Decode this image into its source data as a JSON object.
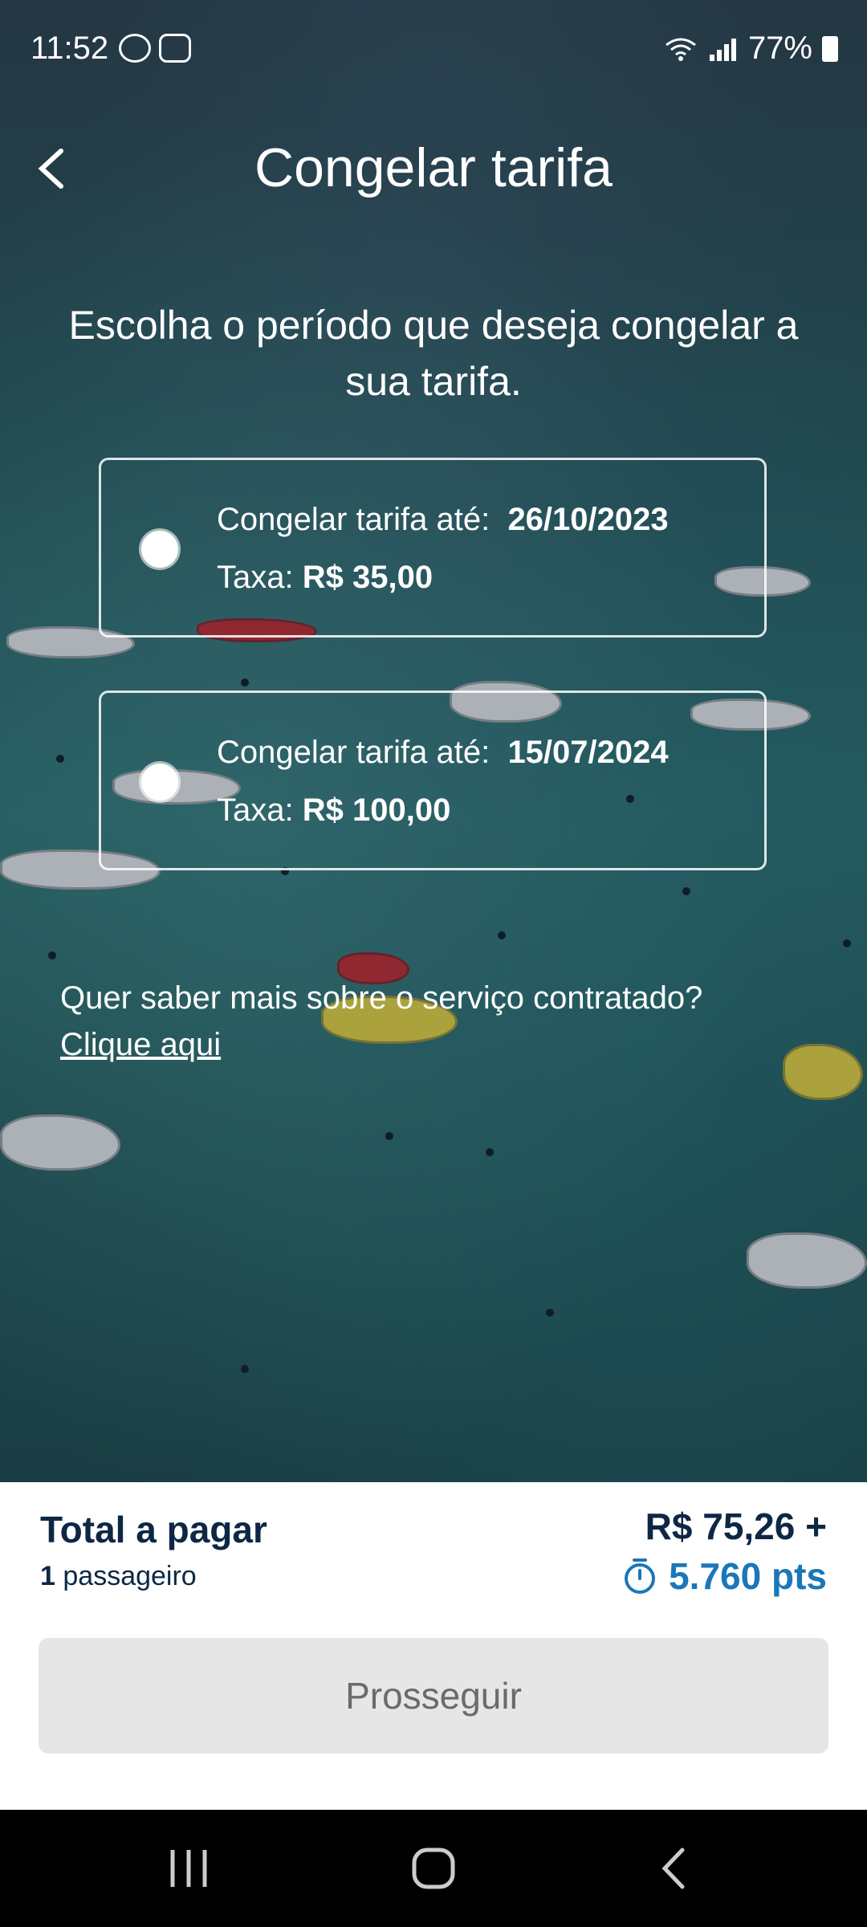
{
  "status_bar": {
    "time": "11:52",
    "battery": "77%"
  },
  "header": {
    "title": "Congelar tarifa"
  },
  "prompt": "Escolha o período que deseja congelar a sua tarifa.",
  "options": [
    {
      "label": "Congelar tarifa até:",
      "date": "26/10/2023",
      "fee_label": "Taxa:",
      "fee": "R$ 35,00",
      "selected": false
    },
    {
      "label": "Congelar tarifa até:",
      "date": "15/07/2024",
      "fee_label": "Taxa:",
      "fee": "R$ 100,00",
      "selected": false
    }
  ],
  "info": {
    "question": "Quer saber mais sobre o serviço contratado?",
    "link": "Clique aqui"
  },
  "summary": {
    "total_label": "Total a pagar",
    "passenger_count": "1",
    "passenger_label": "passageiro",
    "price": "R$ 75,26 +",
    "points": "5.760 pts"
  },
  "actions": {
    "proceed": "Prosseguir"
  },
  "colors": {
    "primary_text": "#0e2745",
    "points_blue": "#1b77b8",
    "button_disabled_bg": "#e6e6e6"
  }
}
